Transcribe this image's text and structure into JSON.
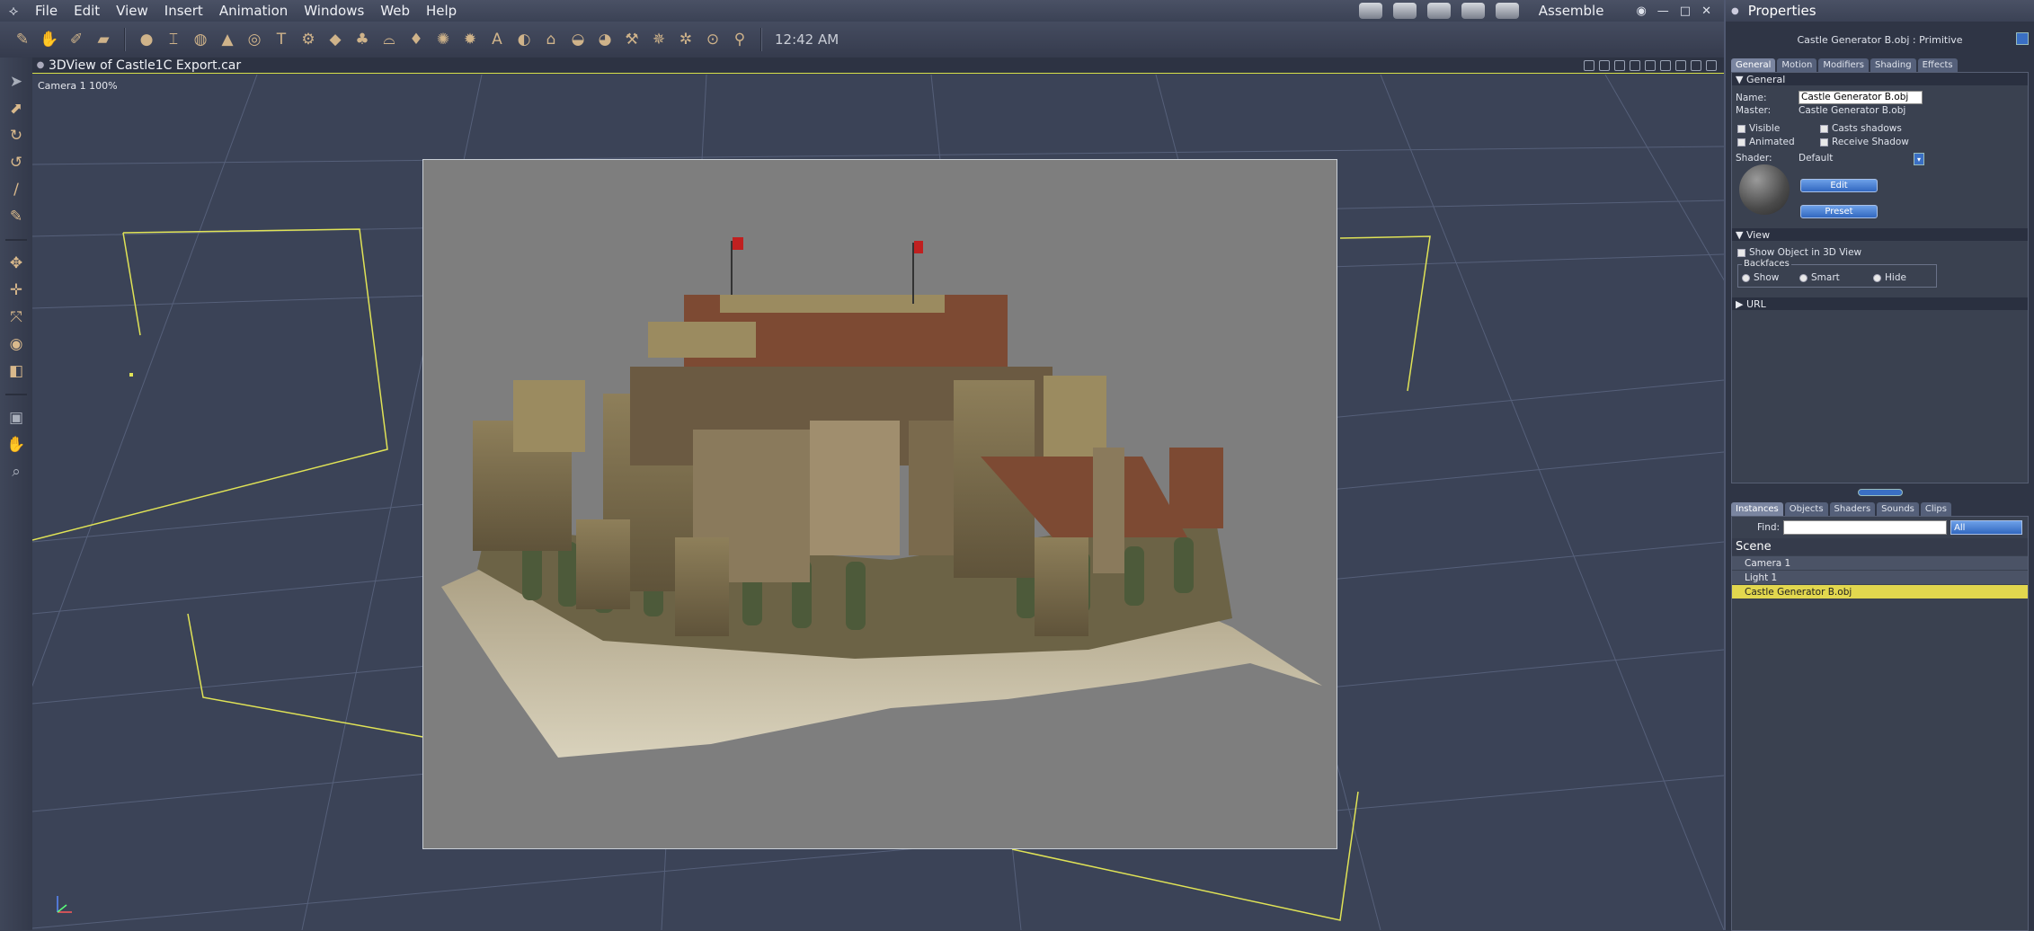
{
  "menu": {
    "items": [
      "File",
      "Edit",
      "View",
      "Insert",
      "Animation",
      "Windows",
      "Web",
      "Help"
    ],
    "room": "Assemble"
  },
  "toolbar": {
    "clock": "12:42 AM"
  },
  "viewport": {
    "title": "3DView of Castle1C Export.car",
    "camera_label": "Camera 1 100%"
  },
  "panel": {
    "title": "Properties",
    "subtitle": "Castle Generator B.obj : Primitive",
    "tabs": [
      "General",
      "Motion",
      "Modifiers",
      "Shading",
      "Effects"
    ],
    "general_header": "General",
    "name_label": "Name:",
    "name_value": "Castle Generator B.obj",
    "master_label": "Master:",
    "master_value": "Castle Generator B.obj",
    "visible": "Visible",
    "casts_shadows": "Casts shadows",
    "animated": "Animated",
    "receive_shadow": "Receive Shadow",
    "shader_label": "Shader:",
    "shader_value": "Default",
    "edit_button": "Edit",
    "preset_button": "Preset",
    "view_header": "View",
    "show_object": "Show Object in 3D View",
    "backfaces_label": "Backfaces",
    "backfaces_options": [
      "Show",
      "Smart",
      "Hide"
    ],
    "url_header": "URL"
  },
  "library": {
    "tabs": [
      "Instances",
      "Objects",
      "Shaders",
      "Sounds",
      "Clips"
    ],
    "find_label": "Find:",
    "filter_value": "All",
    "scene_title": "Scene",
    "items": [
      "Camera 1",
      "Light 1",
      "Castle Generator B.obj"
    ]
  }
}
